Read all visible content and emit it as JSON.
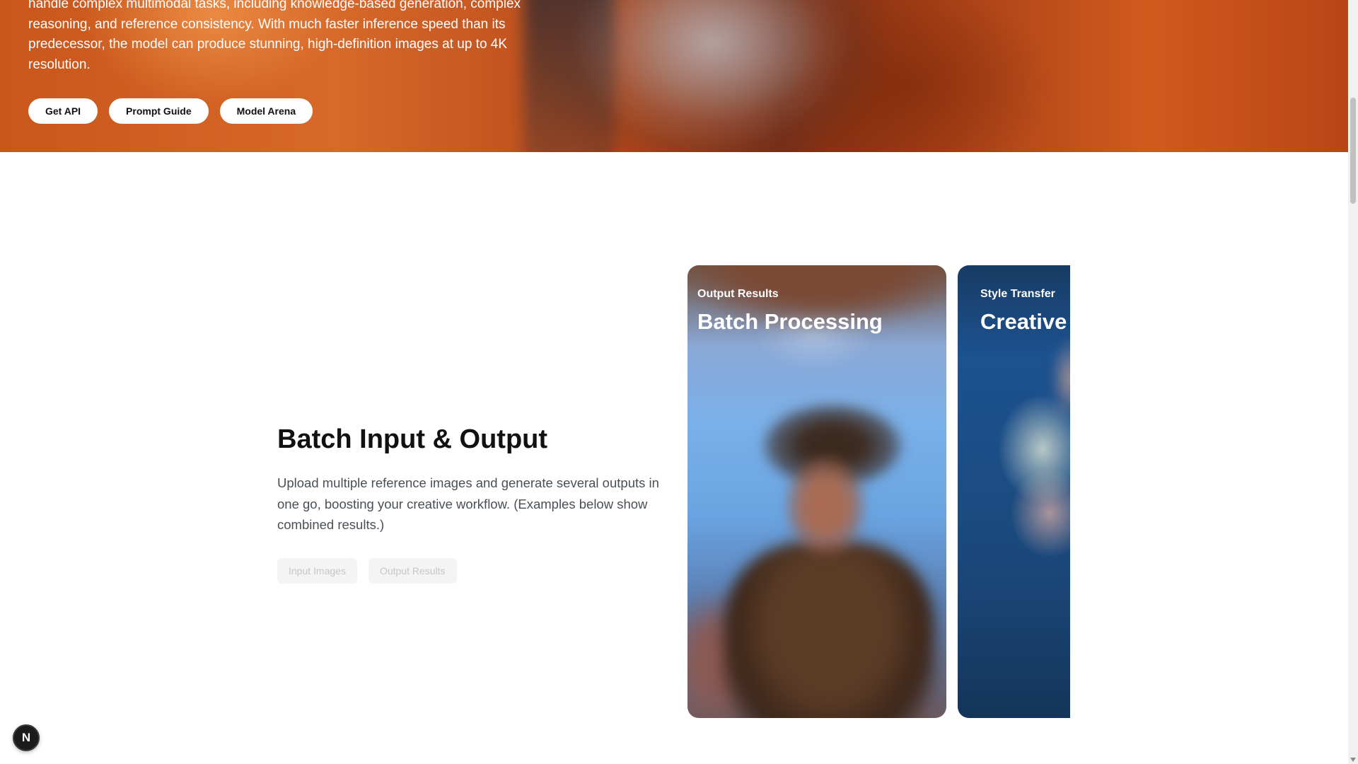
{
  "hero": {
    "description_lines": [
      "handle complex multimodal tasks, including knowledge-based generation, complex",
      "reasoning, and reference consistency. With much faster inference speed than its",
      "predecessor, the model can produce stunning, high-definition images at up to 4K",
      "resolution."
    ],
    "buttons": [
      "Get API",
      "Prompt Guide",
      "Model Arena"
    ]
  },
  "feature": {
    "title": "Batch Input & Output",
    "description": "Upload multiple reference images and generate several outputs in one go, boosting your creative workflow. (Examples below show combined results.)",
    "tabs": [
      "Input Images",
      "Output Results"
    ]
  },
  "cards": [
    {
      "label": "Output Results",
      "heading": "Batch Processing"
    },
    {
      "label": "Style Transfer",
      "heading": "Creative"
    }
  ],
  "badge": {
    "letter": "N"
  },
  "icons": {
    "badge": "n-logo-icon",
    "scroll_down": "chevron-down-icon"
  }
}
